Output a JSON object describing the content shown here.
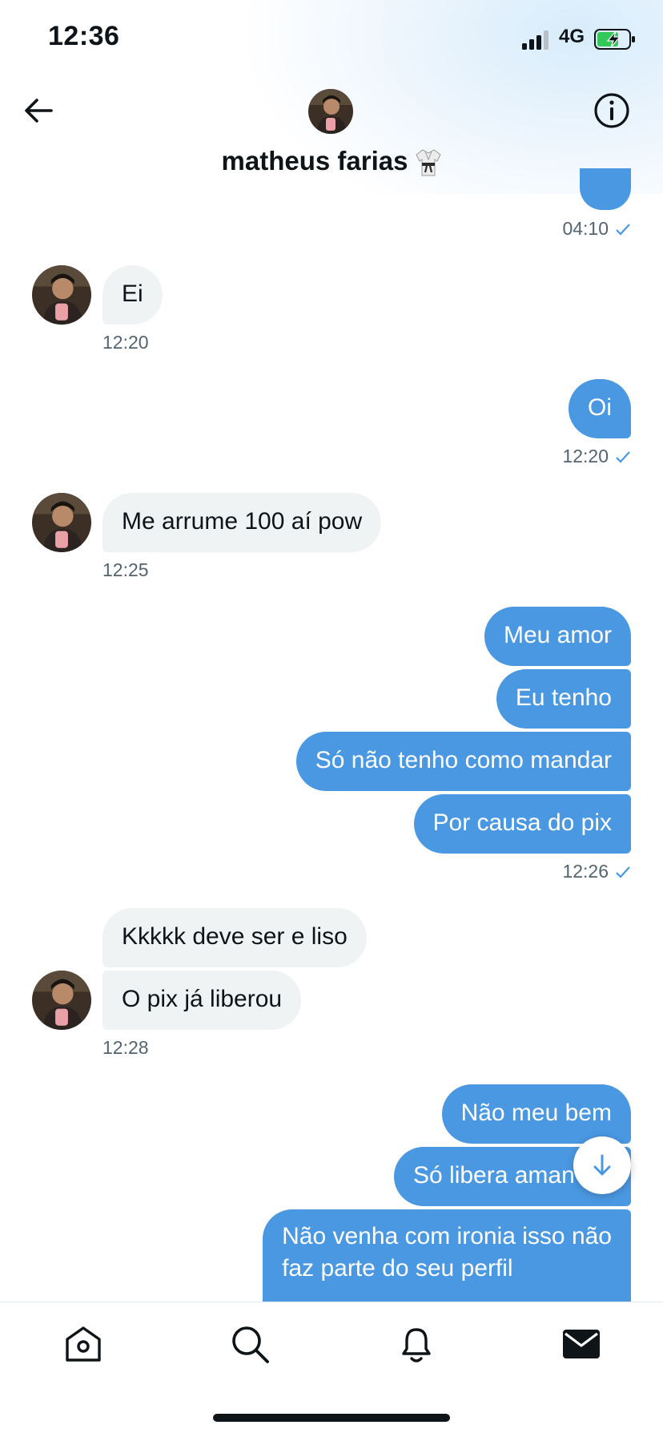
{
  "status_bar": {
    "time": "12:36",
    "network": "4G"
  },
  "header": {
    "contact_name": "matheus farias",
    "name_emoji_icon": "martial-arts-uniform-icon"
  },
  "messages": [
    {
      "id": "m0",
      "sender": "me",
      "text": "",
      "time": "04:10",
      "read": true
    },
    {
      "id": "m1",
      "sender": "contact",
      "text": "Ei",
      "time": "12:20"
    },
    {
      "id": "m2",
      "sender": "me",
      "text": "Oi",
      "time": "12:20",
      "read": true
    },
    {
      "id": "m3",
      "sender": "contact",
      "text": "Me arrume 100 aí pow",
      "time": "12:25"
    },
    {
      "id": "m4",
      "sender": "me",
      "text": "Meu amor"
    },
    {
      "id": "m5",
      "sender": "me",
      "text": "Eu tenho"
    },
    {
      "id": "m6",
      "sender": "me",
      "text": "Só não tenho como mandar"
    },
    {
      "id": "m7",
      "sender": "me",
      "text": "Por causa do pix",
      "time": "12:26",
      "read": true
    },
    {
      "id": "m8",
      "sender": "contact",
      "text": "Kkkkk deve ser e liso"
    },
    {
      "id": "m9",
      "sender": "contact",
      "text": "O pix já liberou",
      "time": "12:28"
    },
    {
      "id": "m10",
      "sender": "me",
      "text": "Não meu bem"
    },
    {
      "id": "m11",
      "sender": "me",
      "text": "Só libera aman"
    },
    {
      "id": "m12",
      "sender": "me",
      "text": "Não venha com ironia isso não",
      "text_line2": "faz parte do seu perfil"
    }
  ],
  "tabs": [
    {
      "name": "home",
      "icon": "home-icon",
      "active": false
    },
    {
      "name": "search",
      "icon": "search-icon",
      "active": false
    },
    {
      "name": "notifications",
      "icon": "bell-icon",
      "active": false
    },
    {
      "name": "messages",
      "icon": "mail-icon",
      "active": true
    }
  ],
  "colors": {
    "sent_bubble": "#4a98e2",
    "received_bubble": "#eff3f4",
    "meta_text": "#536471",
    "check": "#4a98e2"
  }
}
